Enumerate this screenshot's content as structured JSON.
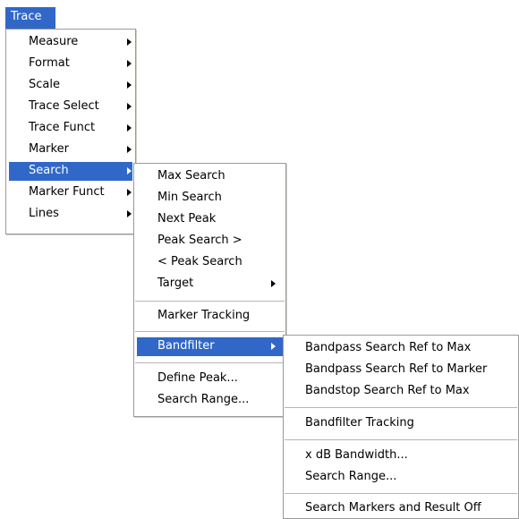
{
  "menubar": {
    "trace_label": "Trace"
  },
  "trace_menu": {
    "items": [
      {
        "label": "Measure"
      },
      {
        "label": "Format"
      },
      {
        "label": "Scale"
      },
      {
        "label": "Trace Select"
      },
      {
        "label": "Trace Funct"
      },
      {
        "label": "Marker"
      },
      {
        "label": "Search"
      },
      {
        "label": "Marker Funct"
      },
      {
        "label": "Lines"
      }
    ],
    "selected": "Search"
  },
  "search_menu": {
    "items": [
      {
        "label": "Max Search"
      },
      {
        "label": "Min Search"
      },
      {
        "label": "Next Peak"
      },
      {
        "label": "Peak Search >"
      },
      {
        "label": "< Peak Search"
      },
      {
        "label": "Target"
      },
      {
        "label": "Marker Tracking"
      },
      {
        "label": "Bandfilter"
      },
      {
        "label": "Define Peak..."
      },
      {
        "label": "Search Range..."
      }
    ],
    "selected": "Bandfilter"
  },
  "bandfilter_menu": {
    "items": [
      {
        "label": "Bandpass Search Ref to Max"
      },
      {
        "label": "Bandpass Search Ref to Marker"
      },
      {
        "label": "Bandstop Search Ref to Max"
      },
      {
        "label": "Bandfilter Tracking"
      },
      {
        "label": "x dB Bandwidth..."
      },
      {
        "label": "Search Range..."
      },
      {
        "label": "Search Markers and Result Off"
      }
    ]
  },
  "colors": {
    "highlight": "#3168c8",
    "menu_background": "#ffffff",
    "menu_border": "#9a9a9a"
  }
}
